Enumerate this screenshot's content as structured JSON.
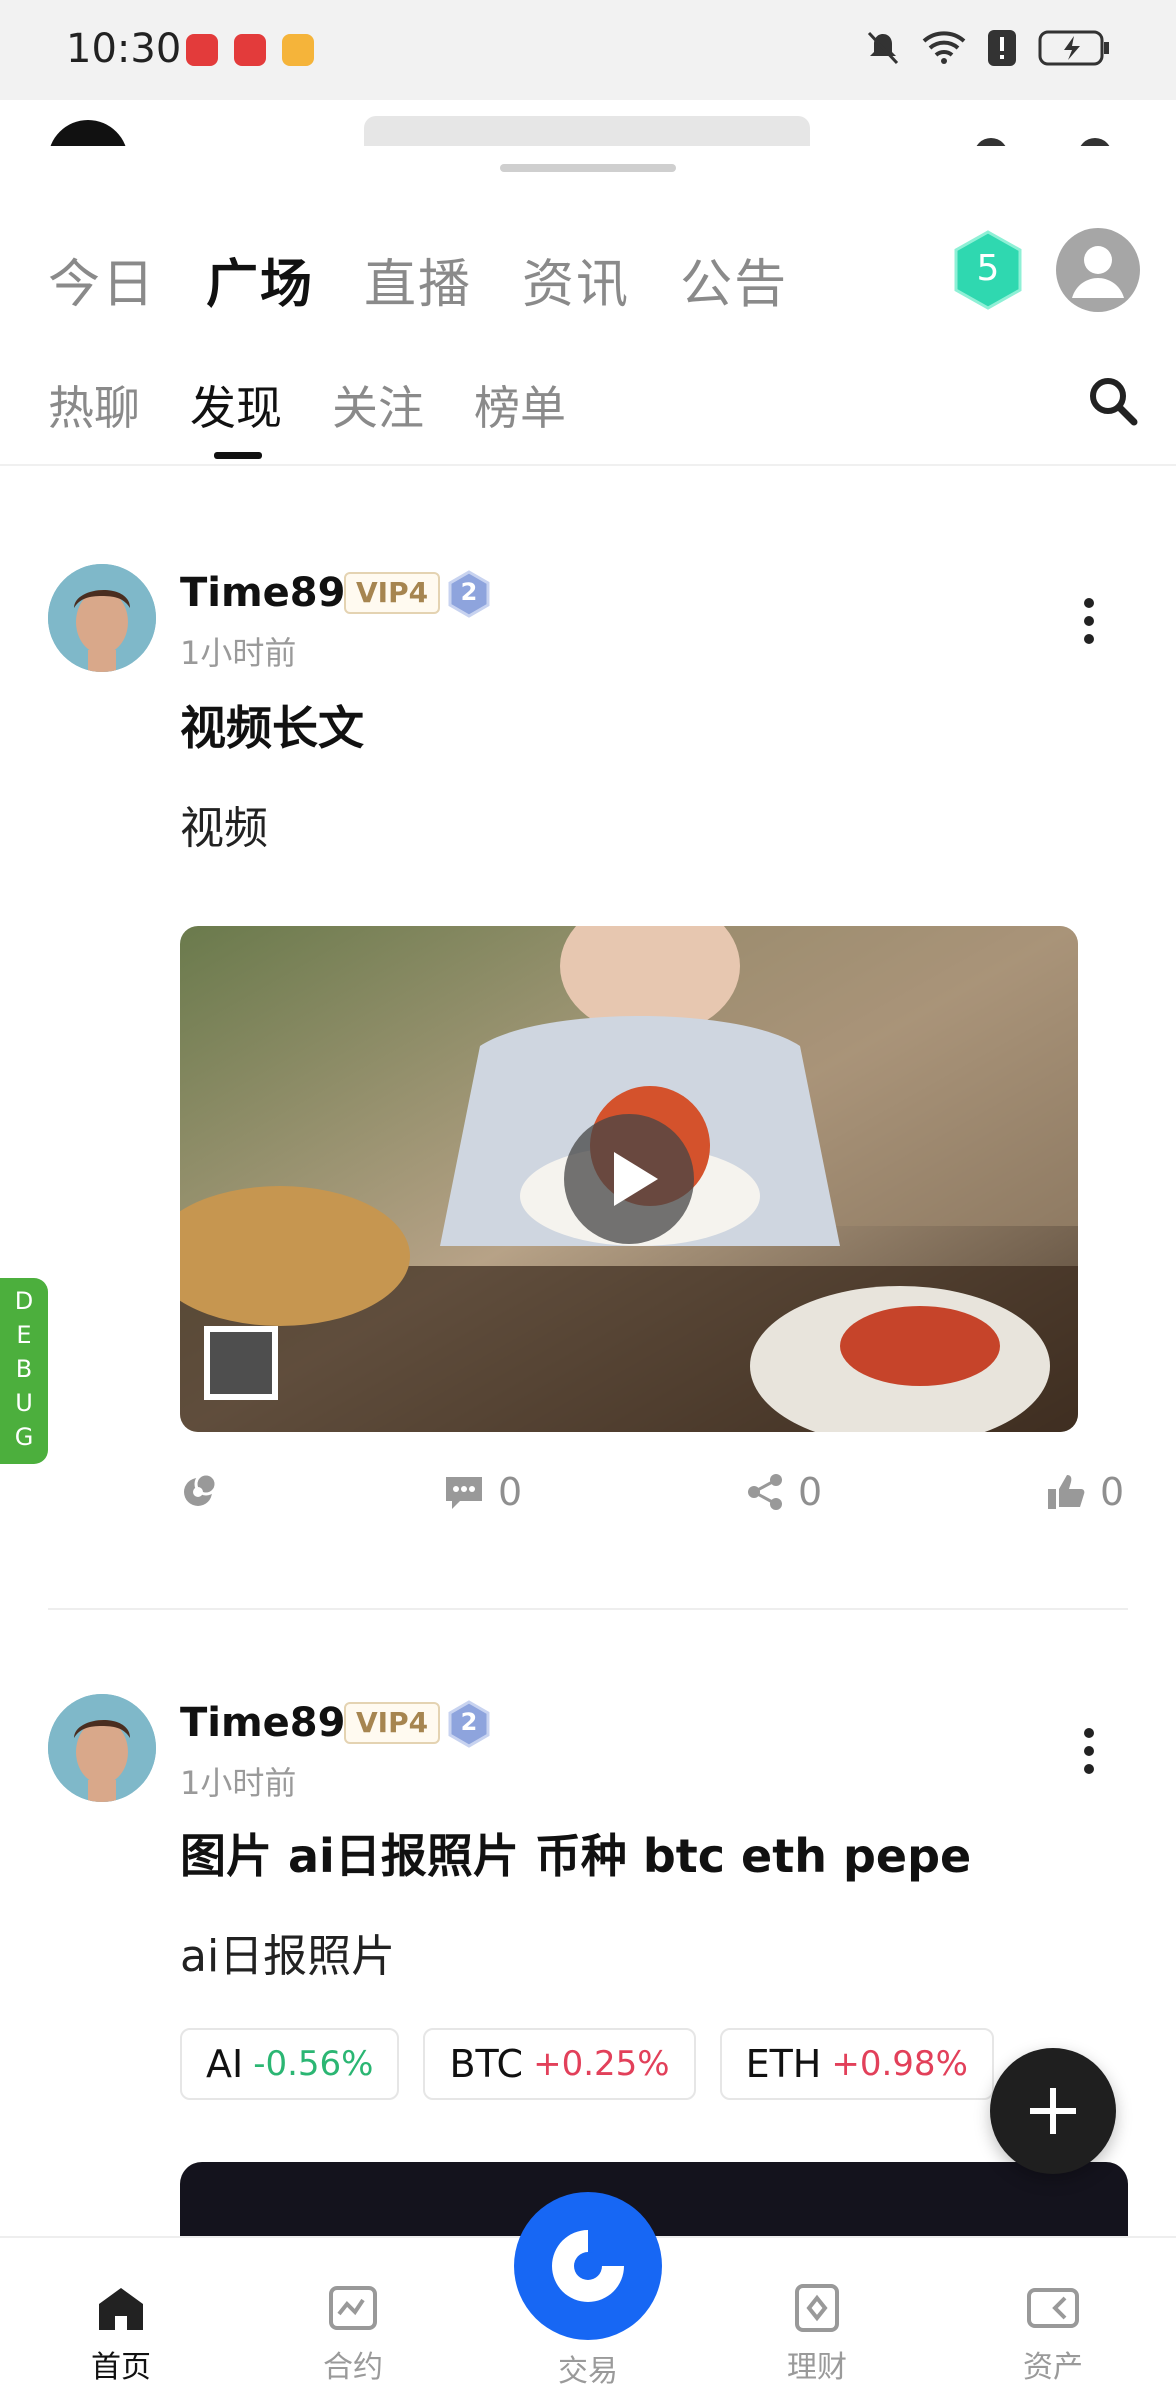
{
  "status_bar": {
    "time": "10:30"
  },
  "main_tabs": [
    "今日",
    "广场",
    "直播",
    "资讯",
    "公告"
  ],
  "level_badge": "5",
  "sub_tabs": [
    "热聊",
    "发现",
    "关注",
    "榜单"
  ],
  "posts": [
    {
      "author": "Time89",
      "vip": "VIP4",
      "level": "2",
      "time": "1小时前",
      "title": "视频长文",
      "body": "视频",
      "comments": "0",
      "shares": "0",
      "likes": "0"
    },
    {
      "author": "Time89",
      "vip": "VIP4",
      "level": "2",
      "time": "1小时前",
      "title": "图片 ai日报照片  币种 btc  eth pepe",
      "body": "ai日报照片",
      "chips": [
        {
          "symbol": "AI",
          "change": "-0.56%",
          "color": "#2bb673"
        },
        {
          "symbol": "BTC",
          "change": "+0.25%",
          "color": "#e2405a"
        },
        {
          "symbol": "ETH",
          "change": "+0.98%",
          "color": "#e2405a"
        }
      ]
    }
  ],
  "debug_label": "DEBUG",
  "bottom_nav": {
    "home": "首页",
    "contract": "合约",
    "trade": "交易",
    "finance": "理财",
    "assets": "资产"
  }
}
